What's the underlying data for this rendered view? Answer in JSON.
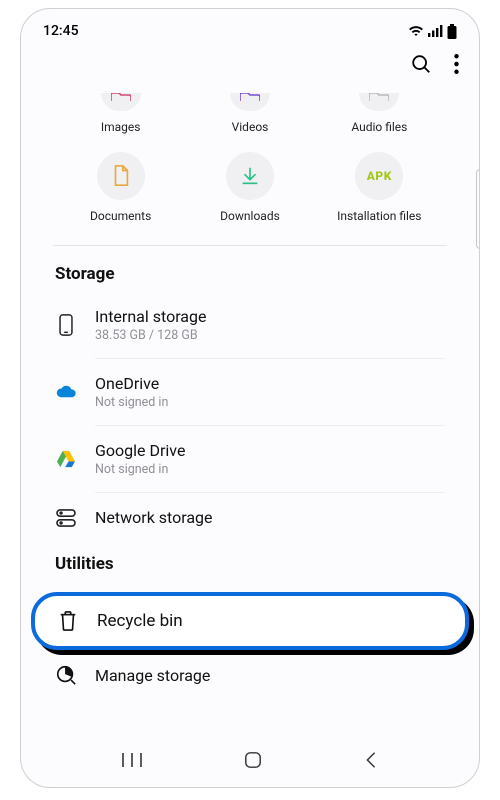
{
  "status": {
    "time": "12:45"
  },
  "categories": {
    "row1": [
      {
        "label": "Images"
      },
      {
        "label": "Videos"
      },
      {
        "label": "Audio files"
      }
    ],
    "row2": [
      {
        "label": "Documents"
      },
      {
        "label": "Downloads"
      },
      {
        "label": "Installation files",
        "badge": "APK"
      }
    ]
  },
  "storage": {
    "title": "Storage",
    "internal": {
      "title": "Internal storage",
      "sub": "38.53 GB / 128 GB"
    },
    "onedrive": {
      "title": "OneDrive",
      "sub": "Not signed in"
    },
    "gdrive": {
      "title": "Google Drive",
      "sub": "Not signed in"
    },
    "network": {
      "title": "Network storage"
    }
  },
  "utilities": {
    "title": "Utilities",
    "recycle": {
      "title": "Recycle bin"
    },
    "manage": {
      "title": "Manage storage"
    }
  }
}
